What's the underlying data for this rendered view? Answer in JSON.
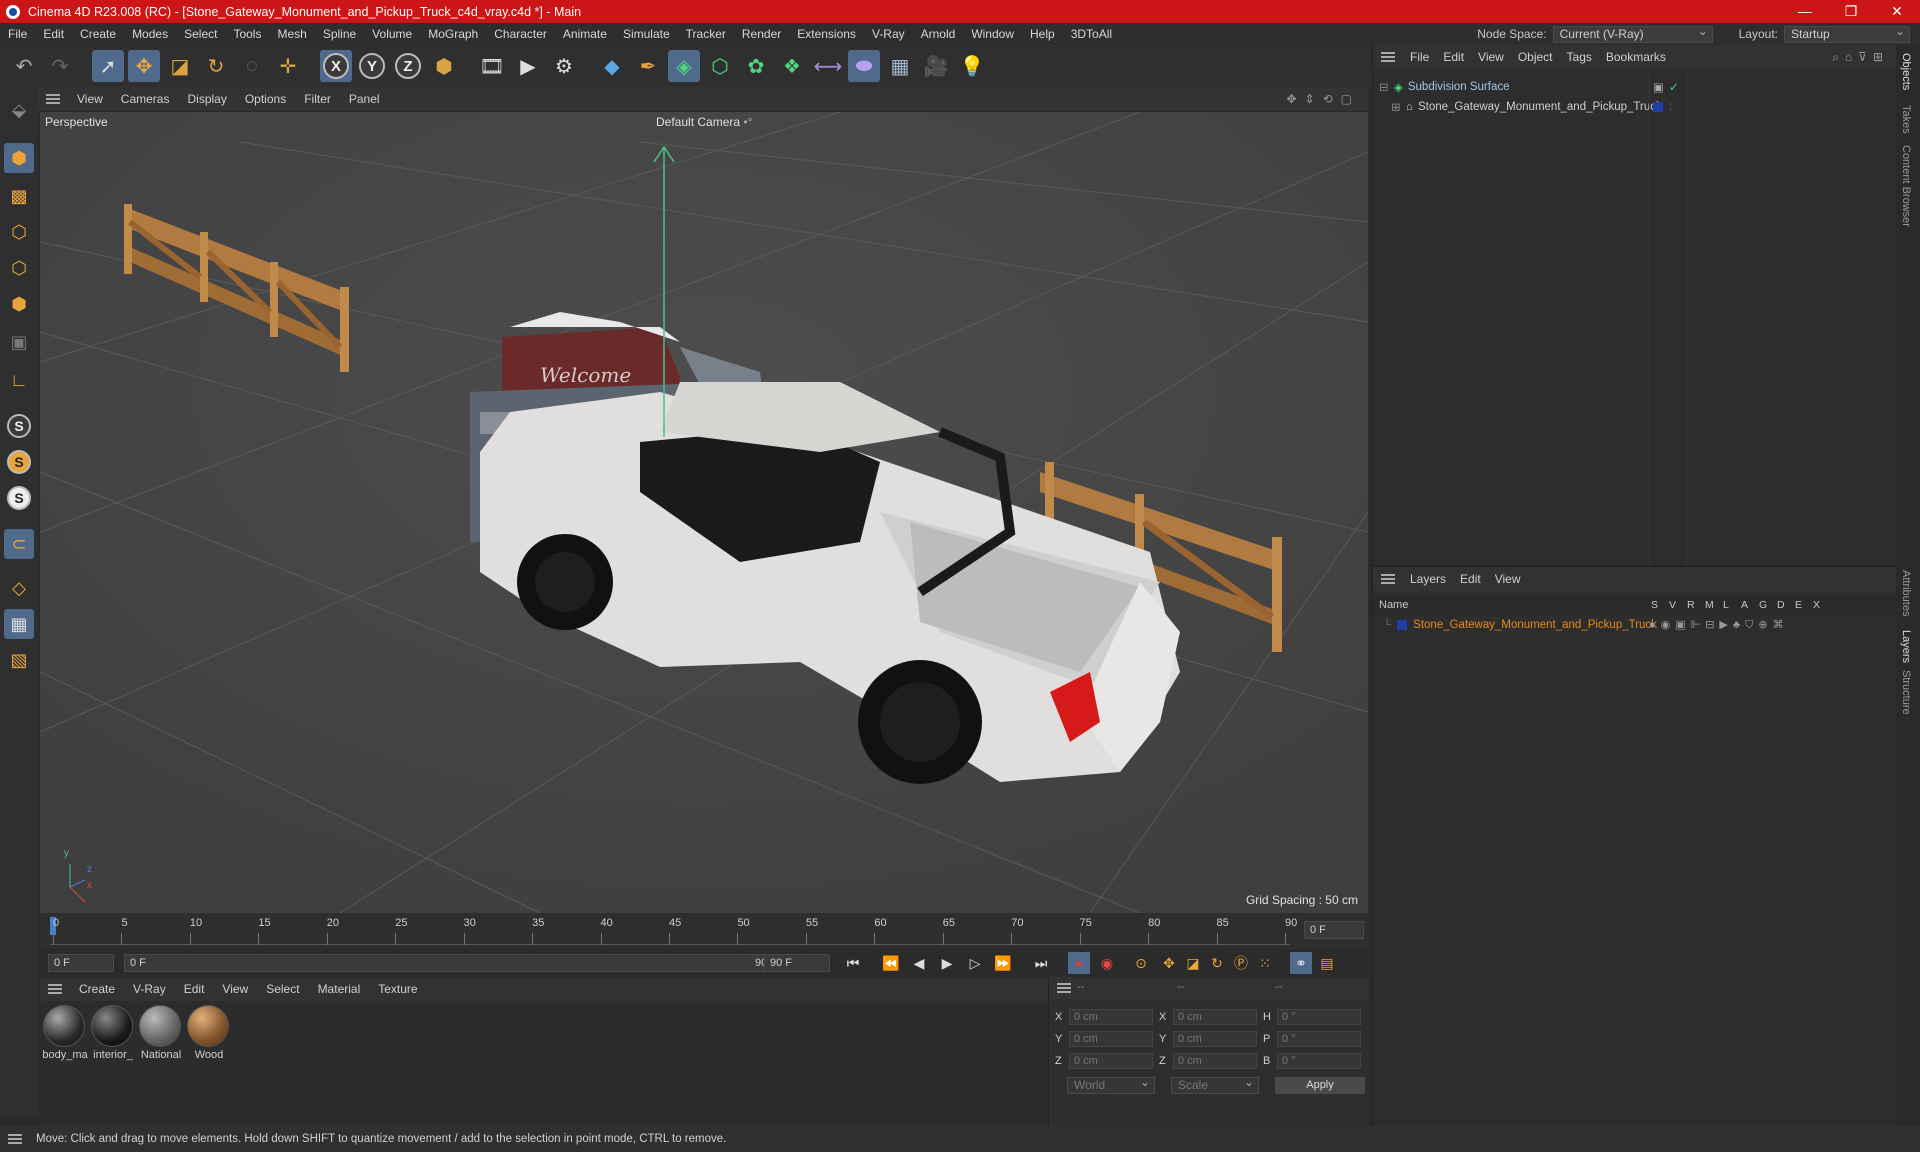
{
  "titlebar": {
    "title": "Cinema 4D R23.008 (RC) - [Stone_Gateway_Monument_and_Pickup_Truck_c4d_vray.c4d *] - Main",
    "minimize": "—",
    "restore": "❐",
    "close": "✕"
  },
  "menubar": {
    "items": [
      "File",
      "Edit",
      "Create",
      "Modes",
      "Select",
      "Tools",
      "Mesh",
      "Spline",
      "Volume",
      "MoGraph",
      "Character",
      "Animate",
      "Simulate",
      "Tracker",
      "Render",
      "Extensions",
      "V-Ray",
      "Arnold",
      "Window",
      "Help",
      "3DToAll"
    ],
    "node_space_label": "Node Space:",
    "node_space_value": "Current (V-Ray)",
    "layout_label": "Layout:",
    "layout_value": "Startup"
  },
  "viewport_menu": {
    "items": [
      "View",
      "Cameras",
      "Display",
      "Options",
      "Filter",
      "Panel"
    ]
  },
  "viewport": {
    "label": "Perspective",
    "camera": "Default Camera",
    "camera_marker": "•°",
    "grid_spacing": "Grid Spacing : 50 cm",
    "axis_y": "y",
    "axis_z": "z",
    "axis_x": "x"
  },
  "timeline": {
    "ticks": [
      "0",
      "5",
      "10",
      "15",
      "20",
      "25",
      "30",
      "35",
      "40",
      "45",
      "50",
      "55",
      "60",
      "65",
      "70",
      "75",
      "80",
      "85",
      "90"
    ],
    "current_frame": "0 F"
  },
  "transport": {
    "start_field": "0 F",
    "range_start": "0 F",
    "range_end": "90 F",
    "end_field": "90 F"
  },
  "material_menu": {
    "items": [
      "Create",
      "V-Ray",
      "Edit",
      "View",
      "Select",
      "Material",
      "Texture"
    ]
  },
  "materials": [
    {
      "label": "body_ma",
      "color": "#2a2a2a"
    },
    {
      "label": "interior_",
      "color": "#1a1a1a"
    },
    {
      "label": "National",
      "color": "#6a6a6a"
    },
    {
      "label": "Wood",
      "color": "#8a5a30"
    }
  ],
  "coords": {
    "header": [
      "--",
      "--",
      "--"
    ],
    "rows": [
      {
        "a": "X",
        "av": "0 cm",
        "b": "X",
        "bv": "0 cm",
        "c": "H",
        "cv": "0 °"
      },
      {
        "a": "Y",
        "av": "0 cm",
        "b": "Y",
        "bv": "0 cm",
        "c": "P",
        "cv": "0 °"
      },
      {
        "a": "Z",
        "av": "0 cm",
        "b": "Z",
        "bv": "0 cm",
        "c": "B",
        "cv": "0 °"
      }
    ],
    "mode1": "World",
    "mode2": "Scale",
    "apply": "Apply"
  },
  "objects_menu": {
    "items": [
      "File",
      "Edit",
      "View",
      "Object",
      "Tags",
      "Bookmarks"
    ]
  },
  "objects": [
    {
      "name": "Subdivision Surface"
    },
    {
      "name": "Stone_Gateway_Monument_and_Pickup_Truck"
    }
  ],
  "layers_menu": {
    "items": [
      "Layers",
      "Edit",
      "View"
    ]
  },
  "layers_header": {
    "name": "Name",
    "cols": [
      "S",
      "V",
      "R",
      "M",
      "L",
      "A",
      "G",
      "D",
      "E",
      "X"
    ]
  },
  "layers": [
    {
      "name": "Stone_Gateway_Monument_and_Pickup_Truck"
    }
  ],
  "right_tabs": [
    "Objects",
    "Takes",
    "Content Browser",
    "Attributes",
    "Layers",
    "Structure"
  ],
  "status": "Move: Click and drag to move elements. Hold down SHIFT to quantize movement / add to the selection in point mode, CTRL to remove.",
  "colors": {
    "title_red": "#cc1517",
    "accent_orange": "#e88a1a",
    "active_blue": "#4f6a8c",
    "layer_blue": "#1f3fa8"
  }
}
